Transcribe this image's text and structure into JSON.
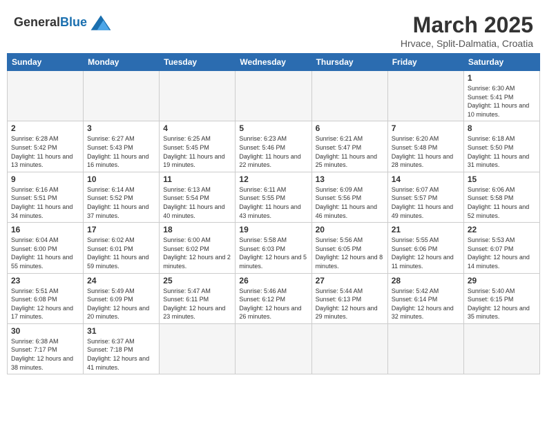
{
  "header": {
    "logo_general": "General",
    "logo_blue": "Blue",
    "month_year": "March 2025",
    "location": "Hrvace, Split-Dalmatia, Croatia"
  },
  "days_of_week": [
    "Sunday",
    "Monday",
    "Tuesday",
    "Wednesday",
    "Thursday",
    "Friday",
    "Saturday"
  ],
  "weeks": [
    [
      {
        "day": "",
        "empty": true
      },
      {
        "day": "",
        "empty": true
      },
      {
        "day": "",
        "empty": true
      },
      {
        "day": "",
        "empty": true
      },
      {
        "day": "",
        "empty": true
      },
      {
        "day": "",
        "empty": true
      },
      {
        "day": "1",
        "info": "Sunrise: 6:30 AM\nSunset: 5:41 PM\nDaylight: 11 hours and 10 minutes."
      }
    ],
    [
      {
        "day": "2",
        "info": "Sunrise: 6:28 AM\nSunset: 5:42 PM\nDaylight: 11 hours and 13 minutes."
      },
      {
        "day": "3",
        "info": "Sunrise: 6:27 AM\nSunset: 5:43 PM\nDaylight: 11 hours and 16 minutes."
      },
      {
        "day": "4",
        "info": "Sunrise: 6:25 AM\nSunset: 5:45 PM\nDaylight: 11 hours and 19 minutes."
      },
      {
        "day": "5",
        "info": "Sunrise: 6:23 AM\nSunset: 5:46 PM\nDaylight: 11 hours and 22 minutes."
      },
      {
        "day": "6",
        "info": "Sunrise: 6:21 AM\nSunset: 5:47 PM\nDaylight: 11 hours and 25 minutes."
      },
      {
        "day": "7",
        "info": "Sunrise: 6:20 AM\nSunset: 5:48 PM\nDaylight: 11 hours and 28 minutes."
      },
      {
        "day": "8",
        "info": "Sunrise: 6:18 AM\nSunset: 5:50 PM\nDaylight: 11 hours and 31 minutes."
      }
    ],
    [
      {
        "day": "9",
        "info": "Sunrise: 6:16 AM\nSunset: 5:51 PM\nDaylight: 11 hours and 34 minutes."
      },
      {
        "day": "10",
        "info": "Sunrise: 6:14 AM\nSunset: 5:52 PM\nDaylight: 11 hours and 37 minutes."
      },
      {
        "day": "11",
        "info": "Sunrise: 6:13 AM\nSunset: 5:54 PM\nDaylight: 11 hours and 40 minutes."
      },
      {
        "day": "12",
        "info": "Sunrise: 6:11 AM\nSunset: 5:55 PM\nDaylight: 11 hours and 43 minutes."
      },
      {
        "day": "13",
        "info": "Sunrise: 6:09 AM\nSunset: 5:56 PM\nDaylight: 11 hours and 46 minutes."
      },
      {
        "day": "14",
        "info": "Sunrise: 6:07 AM\nSunset: 5:57 PM\nDaylight: 11 hours and 49 minutes."
      },
      {
        "day": "15",
        "info": "Sunrise: 6:06 AM\nSunset: 5:58 PM\nDaylight: 11 hours and 52 minutes."
      }
    ],
    [
      {
        "day": "16",
        "info": "Sunrise: 6:04 AM\nSunset: 6:00 PM\nDaylight: 11 hours and 55 minutes."
      },
      {
        "day": "17",
        "info": "Sunrise: 6:02 AM\nSunset: 6:01 PM\nDaylight: 11 hours and 59 minutes."
      },
      {
        "day": "18",
        "info": "Sunrise: 6:00 AM\nSunset: 6:02 PM\nDaylight: 12 hours and 2 minutes."
      },
      {
        "day": "19",
        "info": "Sunrise: 5:58 AM\nSunset: 6:03 PM\nDaylight: 12 hours and 5 minutes."
      },
      {
        "day": "20",
        "info": "Sunrise: 5:56 AM\nSunset: 6:05 PM\nDaylight: 12 hours and 8 minutes."
      },
      {
        "day": "21",
        "info": "Sunrise: 5:55 AM\nSunset: 6:06 PM\nDaylight: 12 hours and 11 minutes."
      },
      {
        "day": "22",
        "info": "Sunrise: 5:53 AM\nSunset: 6:07 PM\nDaylight: 12 hours and 14 minutes."
      }
    ],
    [
      {
        "day": "23",
        "info": "Sunrise: 5:51 AM\nSunset: 6:08 PM\nDaylight: 12 hours and 17 minutes."
      },
      {
        "day": "24",
        "info": "Sunrise: 5:49 AM\nSunset: 6:09 PM\nDaylight: 12 hours and 20 minutes."
      },
      {
        "day": "25",
        "info": "Sunrise: 5:47 AM\nSunset: 6:11 PM\nDaylight: 12 hours and 23 minutes."
      },
      {
        "day": "26",
        "info": "Sunrise: 5:46 AM\nSunset: 6:12 PM\nDaylight: 12 hours and 26 minutes."
      },
      {
        "day": "27",
        "info": "Sunrise: 5:44 AM\nSunset: 6:13 PM\nDaylight: 12 hours and 29 minutes."
      },
      {
        "day": "28",
        "info": "Sunrise: 5:42 AM\nSunset: 6:14 PM\nDaylight: 12 hours and 32 minutes."
      },
      {
        "day": "29",
        "info": "Sunrise: 5:40 AM\nSunset: 6:15 PM\nDaylight: 12 hours and 35 minutes."
      }
    ],
    [
      {
        "day": "30",
        "info": "Sunrise: 6:38 AM\nSunset: 7:17 PM\nDaylight: 12 hours and 38 minutes."
      },
      {
        "day": "31",
        "info": "Sunrise: 6:37 AM\nSunset: 7:18 PM\nDaylight: 12 hours and 41 minutes."
      },
      {
        "day": "",
        "empty": true
      },
      {
        "day": "",
        "empty": true
      },
      {
        "day": "",
        "empty": true
      },
      {
        "day": "",
        "empty": true
      },
      {
        "day": "",
        "empty": true
      }
    ]
  ]
}
